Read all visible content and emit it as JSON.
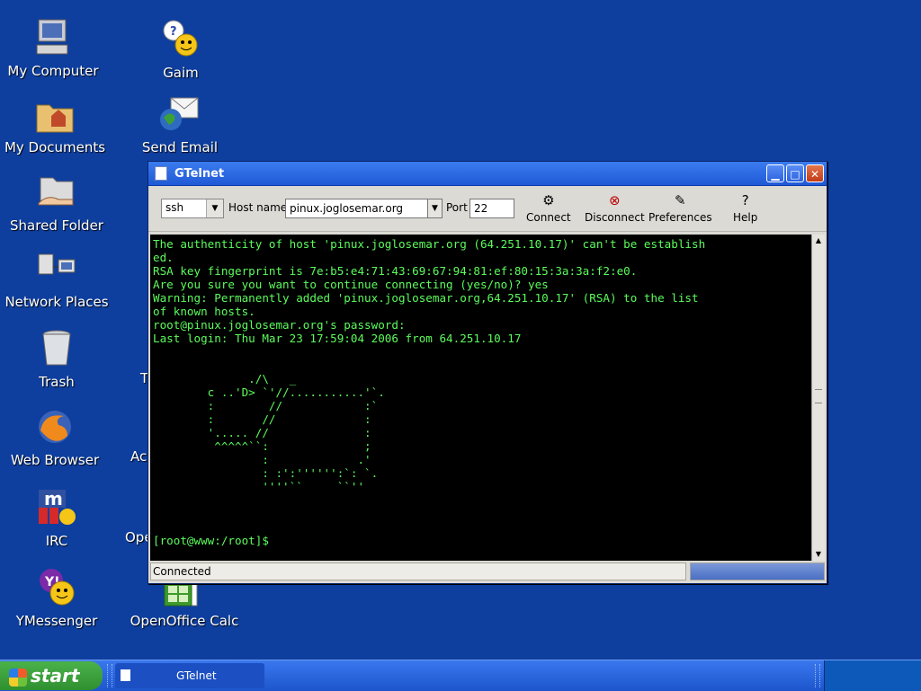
{
  "desktop": {
    "icons_left": [
      {
        "label": "My Computer",
        "icon": "computer-icon"
      },
      {
        "label": "My Documents",
        "icon": "documents-folder-icon"
      },
      {
        "label": "Shared Folder",
        "icon": "shared-folder-icon"
      },
      {
        "label": "Network Places",
        "icon": "network-icon"
      },
      {
        "label": "Trash",
        "icon": "trash-icon"
      },
      {
        "label": "Web Browser",
        "icon": "firefox-icon"
      },
      {
        "label": "IRC",
        "icon": "irc-icon"
      },
      {
        "label": "YMessenger",
        "icon": "yahoo-messenger-icon"
      }
    ],
    "icons_right": [
      {
        "label": "Gaim",
        "icon": "gaim-icon"
      },
      {
        "label": "Send Email",
        "icon": "email-icon"
      },
      {
        "label": "OpenOffice Calc",
        "icon": "calc-icon"
      }
    ],
    "partial_labels": [
      "T",
      "Ac",
      "Ope"
    ]
  },
  "window": {
    "title": "GTelnet",
    "buttons": {
      "minimize": "▁",
      "maximize": "□",
      "close": "✕"
    },
    "toolbar": {
      "protocol": "ssh",
      "host_label": "Host name",
      "host_value": "pinux.joglosemar.org",
      "port_label": "Port",
      "port_value": "22",
      "connect": "Connect",
      "disconnect": "Disconnect",
      "preferences": "Preferences",
      "help": "Help"
    },
    "terminal": "The authenticity of host 'pinux.joglosemar.org (64.251.10.17)' can't be establish\ned.\nRSA key fingerprint is 7e:b5:e4:71:43:69:67:94:81:ef:80:15:3a:3a:f2:e0.\nAre you sure you want to continue connecting (yes/no)? yes\nWarning: Permanently added 'pinux.joglosemar.org,64.251.10.17' (RSA) to the list\nof known hosts.\nroot@pinux.joglosemar.org's password:\nLast login: Thu Mar 23 17:59:04 2006 from 64.251.10.17\n\n\n              ./\\   _\n        c ..'D> `'//...........'`.\n        :        //            :`\n        :       //             :\n        '..... //              :\n         ^^^^^``:              ;\n                :             .'\n                : :':'''''':`: `.\n                ''''``     ``''\n\n\n\n[root@www:/root]$",
    "status": "Connected"
  },
  "taskbar": {
    "start_label": "start",
    "task_label": "GTelnet"
  }
}
